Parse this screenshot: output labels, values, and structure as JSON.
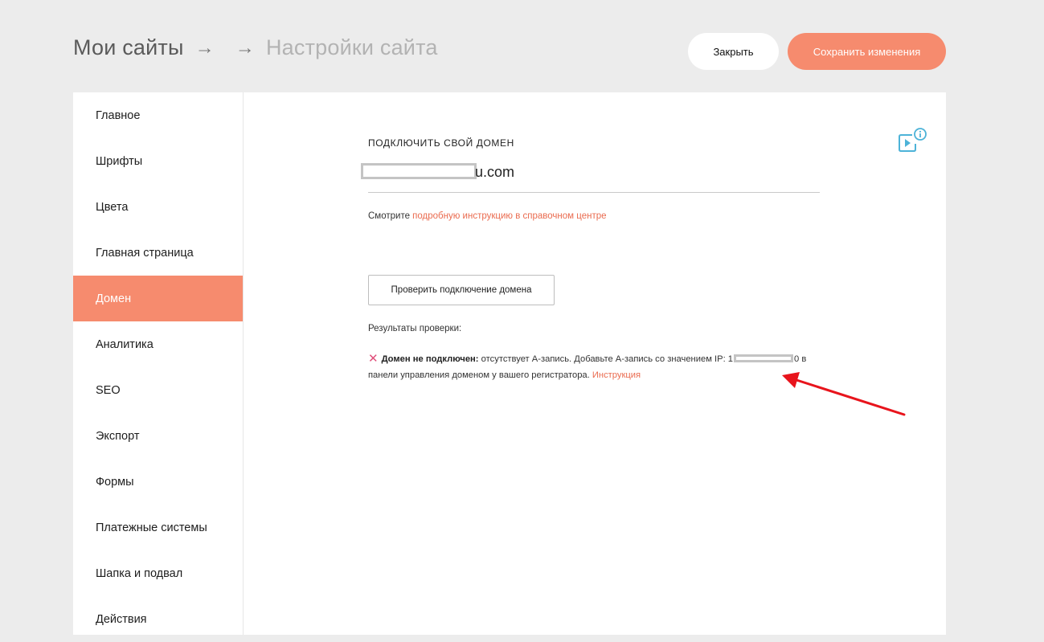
{
  "breadcrumb": {
    "root": "Мои сайты",
    "arrow": "→",
    "current": "Настройки сайта"
  },
  "header_buttons": {
    "close_label": "Закрыть",
    "save_label": "Сохранить изменения"
  },
  "colors": {
    "accent": "#f68b6e",
    "link": "#ea6b4f",
    "error_icon": "#e0507b",
    "help_icon": "#4db3d8",
    "annotation_arrow": "#e8141c"
  },
  "sidebar": {
    "items": [
      {
        "label": "Главное"
      },
      {
        "label": "Шрифты"
      },
      {
        "label": "Цвета"
      },
      {
        "label": "Главная страница"
      },
      {
        "label": "Домен",
        "active": true
      },
      {
        "label": "Аналитика"
      },
      {
        "label": "SEO"
      },
      {
        "label": "Экспорт"
      },
      {
        "label": "Формы"
      },
      {
        "label": "Платежные системы"
      },
      {
        "label": "Шапка и подвал"
      },
      {
        "label": "Действия"
      }
    ]
  },
  "domain_section": {
    "title": "ПОДКЛЮЧИТЬ СВОЙ ДОМЕН",
    "domain_visible_suffix": "u.com",
    "hint_prefix": "Смотрите ",
    "hint_link": "подробную инструкцию в справочном центре",
    "check_button": "Проверить подключение домена",
    "results_label": "Результаты проверки:",
    "result_icon": "close-x-icon",
    "result_status": "Домен не подключен:",
    "result_text_before_ip": " отсутствует A-запись. Добавьте A-запись со значением IP: 1",
    "result_ip_end": "0",
    "result_text_after_ip": " в панели управления доменом у вашего регистратора. ",
    "result_link": "Инструкция"
  },
  "help": {
    "icon": "video-info-icon"
  }
}
